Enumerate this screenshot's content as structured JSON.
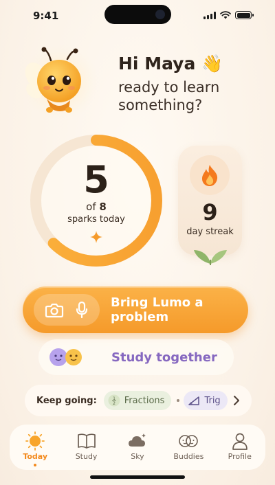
{
  "status": {
    "time": "9:41"
  },
  "greeting": {
    "title": "Hi Maya 👋",
    "subtitle": "ready to learn something?"
  },
  "progress": {
    "count": "5",
    "of_prefix": "of",
    "total": "8",
    "label": "sparks today",
    "fraction": 0.625
  },
  "streak": {
    "days": "9",
    "label": "day streak"
  },
  "cta": {
    "label": "Bring Lumo a problem"
  },
  "together": {
    "label": "Study together"
  },
  "keep_going": {
    "label": "Keep going:",
    "chips": [
      {
        "label": "Fractions",
        "icon": "fraction-icon"
      },
      {
        "label": "Trig",
        "icon": "triangle-icon"
      }
    ]
  },
  "tabs": [
    {
      "label": "Today",
      "icon": "sun-icon",
      "active": true
    },
    {
      "label": "Study",
      "icon": "book-icon",
      "active": false
    },
    {
      "label": "Sky",
      "icon": "cloud-icon",
      "active": false
    },
    {
      "label": "Buddies",
      "icon": "buddies-icon",
      "active": false
    },
    {
      "label": "Profile",
      "icon": "person-icon",
      "active": false
    }
  ],
  "colors": {
    "accent": "#f59a2a",
    "purple": "#8668c0",
    "background": "#fbf3ea"
  }
}
